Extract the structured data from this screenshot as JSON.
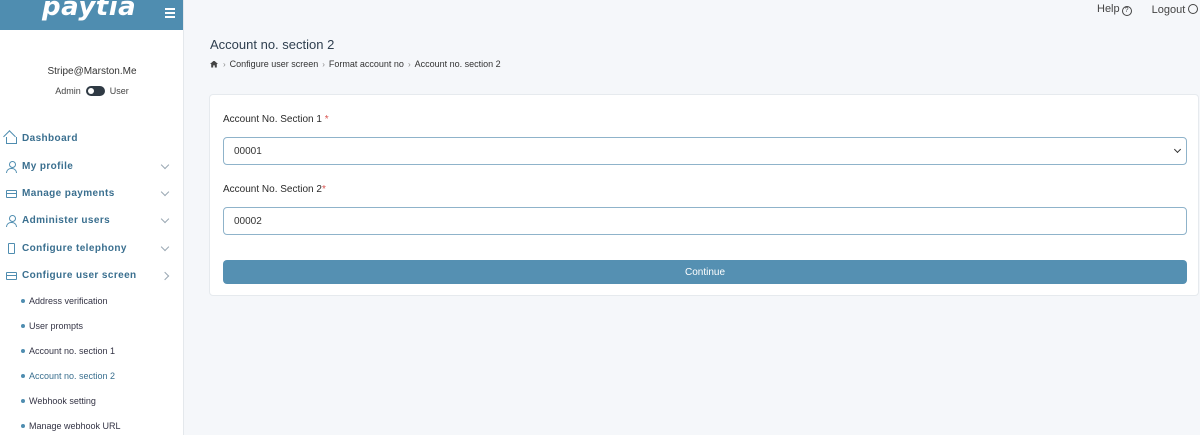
{
  "brand": {
    "name": "paytia"
  },
  "user": {
    "email": "Stripe@Marston.Me",
    "role_left": "Admin",
    "role_right": "User"
  },
  "nav": {
    "items": [
      {
        "label": "Dashboard",
        "icon": "home-icon"
      },
      {
        "label": "My profile",
        "icon": "user-icon"
      },
      {
        "label": "Manage payments",
        "icon": "card-icon"
      },
      {
        "label": "Administer users",
        "icon": "user-icon"
      },
      {
        "label": "Configure telephony",
        "icon": "phone-icon"
      },
      {
        "label": "Configure user screen",
        "icon": "screen-icon"
      }
    ],
    "sub_items": [
      {
        "label": "Address verification"
      },
      {
        "label": "User prompts"
      },
      {
        "label": "Account no. section 1"
      },
      {
        "label": "Account no. section 2"
      },
      {
        "label": "Webhook setting"
      },
      {
        "label": "Manage webhook URL"
      }
    ]
  },
  "topbar": {
    "help": "Help",
    "logout": "Logout"
  },
  "page": {
    "title": "Account no. section 2"
  },
  "breadcrumb": [
    "Configure user screen",
    "Format account no",
    "Account no. section 2"
  ],
  "form": {
    "section1_label": "Account No. Section 1",
    "section1_value": "00001",
    "section2_label": "Account No. Section 2",
    "section2_value": "00002",
    "required_mark": "*",
    "continue_label": "Continue"
  },
  "colors": {
    "accent": "#4f8db0",
    "button": "#5590b2",
    "required": "#d9534f"
  }
}
